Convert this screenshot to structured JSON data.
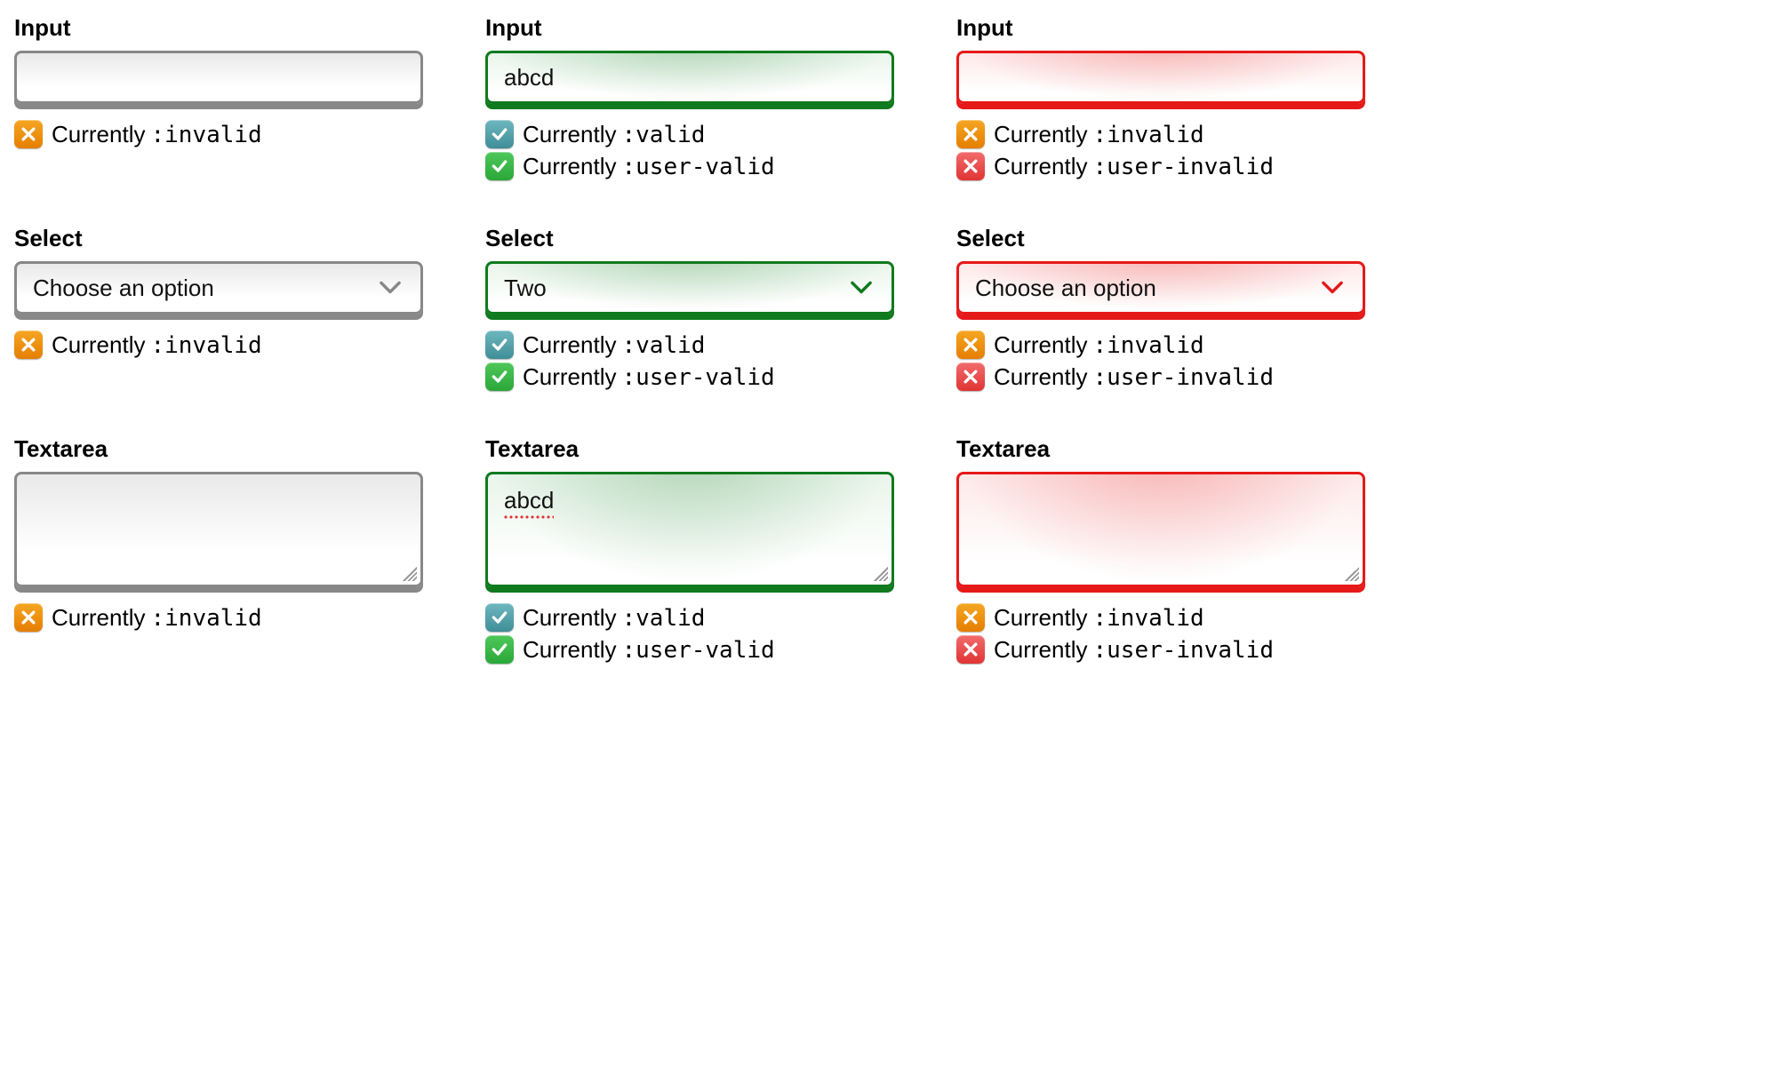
{
  "labels": {
    "input": "Input",
    "select": "Select",
    "textarea": "Textarea"
  },
  "status_prefix": "Currently ",
  "pseudo": {
    "invalid": ":invalid",
    "valid": ":valid",
    "user_valid": ":user-valid",
    "user_invalid": ":user-invalid"
  },
  "values": {
    "col1": {
      "input": "",
      "select": "Choose an option",
      "textarea": ""
    },
    "col2": {
      "input": "abcd",
      "select": "Two",
      "textarea": "abcd"
    },
    "col3": {
      "input": "",
      "select": "Choose an option",
      "textarea": ""
    }
  },
  "colors": {
    "neutral": "#888888",
    "valid": "#0f7a1e",
    "invalid": "#e61919",
    "badge_orange": "#e67e00",
    "badge_teal": "#3f8e97",
    "badge_green": "#2aa838",
    "badge_red": "#e03434"
  }
}
